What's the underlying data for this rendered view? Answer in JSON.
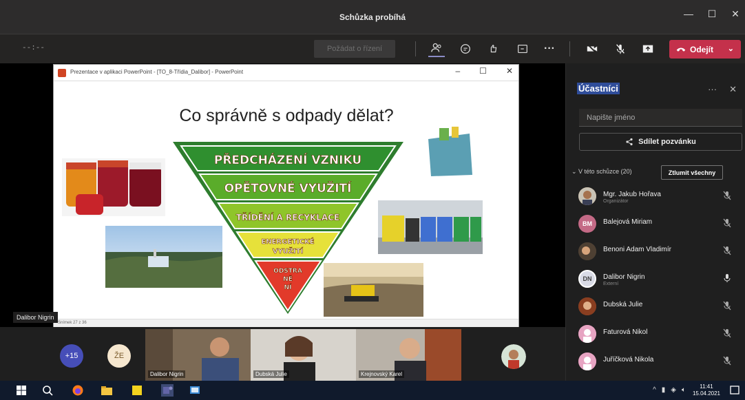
{
  "window": {
    "title": "Schůzka probíhá"
  },
  "toolbar": {
    "timer": "--:--",
    "request_label": "Požádat o řízení",
    "leave_label": "Odejít"
  },
  "powerpoint": {
    "window_title": "Prezentace v aplikaci PowerPoint - [TO_8-Třídia_Dalibor] - PowerPoint",
    "status": "Snímek 27 z 36",
    "slide_title": "Co správně s odpady dělat?",
    "pyramid_levels": [
      "PŘEDCHÁZENÍ VZNIKU",
      "OPĚTOVNÉ VYUŽITÍ",
      "TŘÍDĚNÍ A RECYKLACE",
      "ENERGETICKÉ",
      "VYUŽITÍ",
      "ODSTRA",
      "NĚ",
      "NÍ"
    ]
  },
  "stage": {
    "presenter_name": "Dalibor Nigrin"
  },
  "participants": {
    "title": "Účastníci",
    "search_placeholder": "Napište jméno",
    "share_label": "Sdílet pozvánku",
    "section_label": "V této schůzce (20)",
    "mute_all_label": "Ztlumit všechny",
    "people": [
      {
        "name": "Mgr. Jakub Hořava",
        "role": "Organizátor",
        "initials": "",
        "muted": true
      },
      {
        "name": "Balejová Miriam",
        "role": "",
        "initials": "BM",
        "muted": true
      },
      {
        "name": "Benoni Adam Vladimír",
        "role": "",
        "initials": "",
        "muted": true
      },
      {
        "name": "Dalibor Nigrin",
        "role": "Externí",
        "initials": "DN",
        "muted": false
      },
      {
        "name": "Dubská Julie",
        "role": "",
        "initials": "",
        "muted": true
      },
      {
        "name": "Faturová Nikol",
        "role": "",
        "initials": "",
        "muted": true
      },
      {
        "name": "Juříčková Nikola",
        "role": "",
        "initials": "",
        "muted": true
      }
    ]
  },
  "strip": {
    "more_count": "+15",
    "initials_bubble": "ŽE",
    "tiles": [
      "Dalibor Nigrin",
      "Dubská Julie",
      "Krejnovský Karel"
    ]
  },
  "taskbar": {
    "time": "11:41",
    "date": "15.04.2021"
  },
  "colors": {
    "accent": "#c4314b",
    "teams_purple": "#6264a7",
    "taskbar": "#101a2c"
  }
}
